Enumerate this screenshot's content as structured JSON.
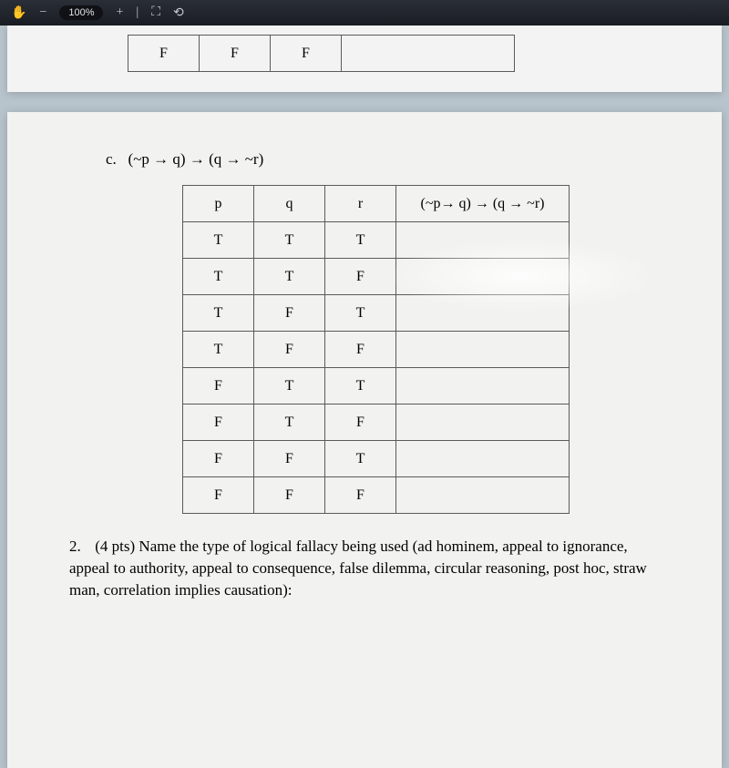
{
  "toolbar": {
    "zoom_label": "100%"
  },
  "top_table": {
    "row": [
      "F",
      "F",
      "F",
      ""
    ]
  },
  "section_c": {
    "letter": "c.",
    "expression": "(~p → q) → (q → ~r)",
    "headers": {
      "p": "p",
      "q": "q",
      "r": "r",
      "result": "(~p→ q) → (q → ~r)"
    },
    "rows": [
      {
        "p": "T",
        "q": "T",
        "r": "T",
        "res": ""
      },
      {
        "p": "T",
        "q": "T",
        "r": "F",
        "res": ""
      },
      {
        "p": "T",
        "q": "F",
        "r": "T",
        "res": ""
      },
      {
        "p": "T",
        "q": "F",
        "r": "F",
        "res": ""
      },
      {
        "p": "F",
        "q": "T",
        "r": "T",
        "res": ""
      },
      {
        "p": "F",
        "q": "T",
        "r": "F",
        "res": ""
      },
      {
        "p": "F",
        "q": "F",
        "r": "T",
        "res": ""
      },
      {
        "p": "F",
        "q": "F",
        "r": "F",
        "res": ""
      }
    ]
  },
  "question2": {
    "num": "2.",
    "text": "(4 pts) Name the type of logical fallacy being used (ad hominem, appeal to ignorance, appeal to authority, appeal to consequence, false dilemma, circular reasoning, post hoc, straw man, correlation implies causation):"
  }
}
